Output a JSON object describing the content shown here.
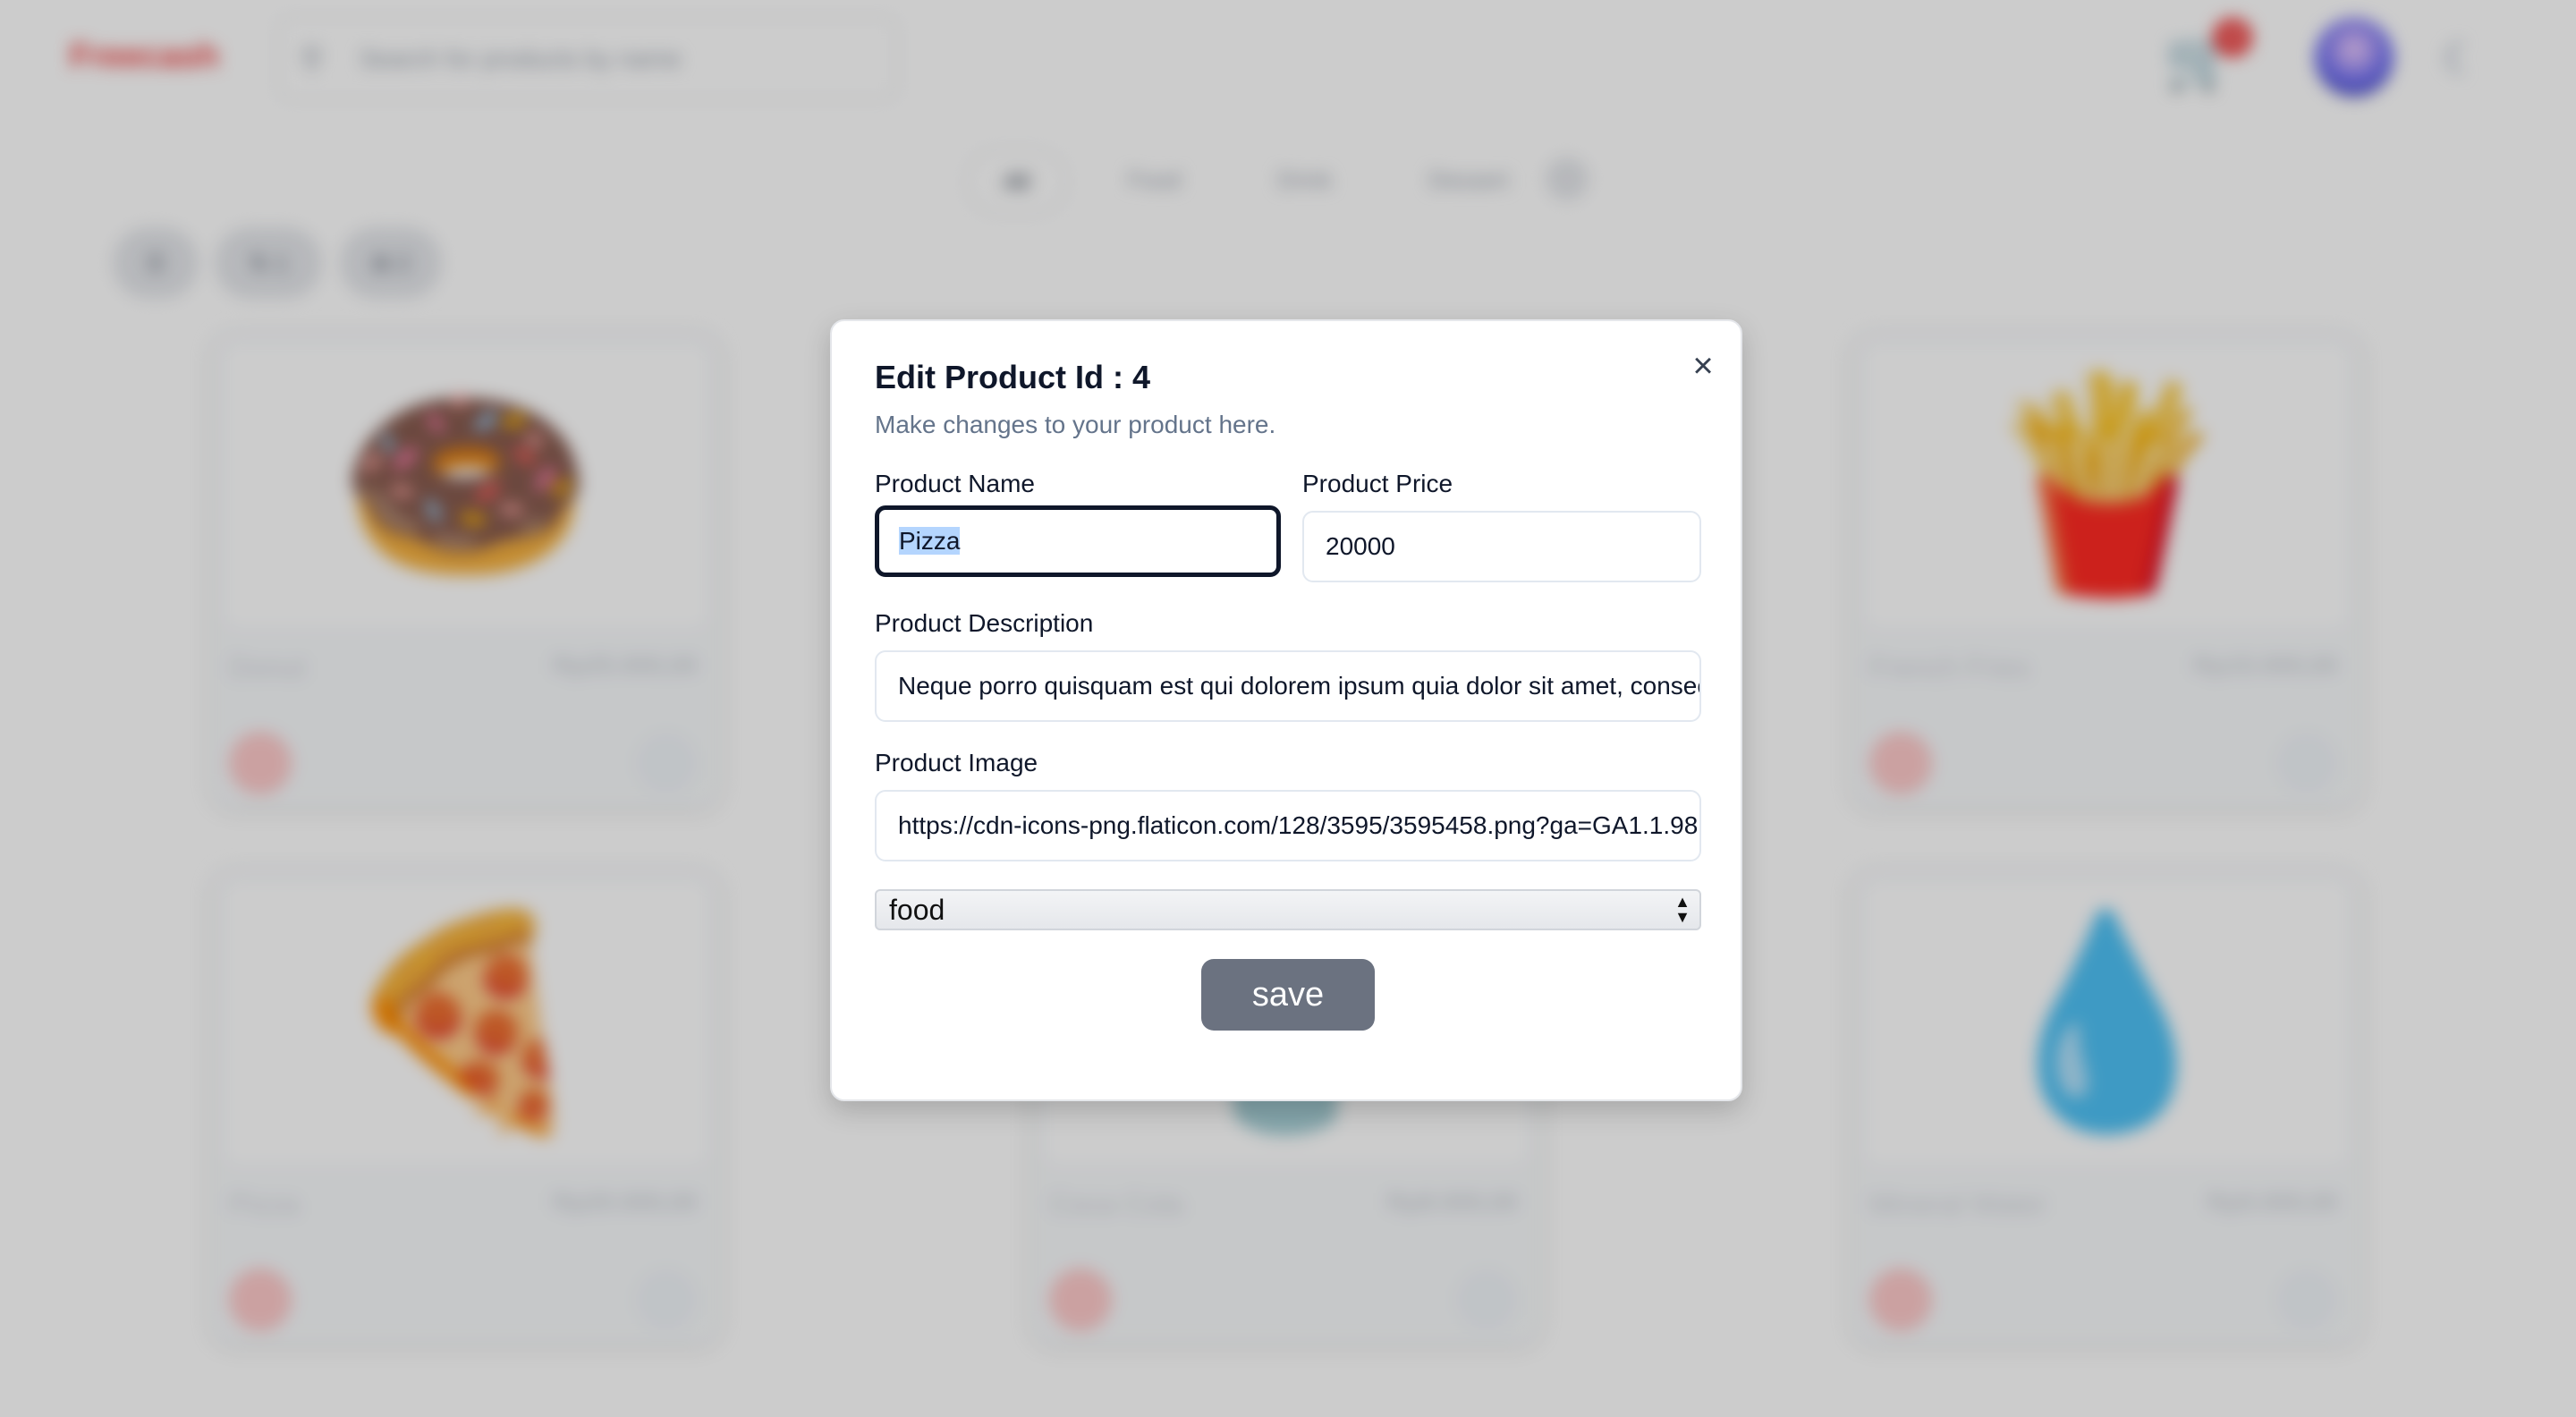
{
  "background": {
    "logo": "Freecash",
    "search_placeholder": "Search for products by name",
    "cart_count": "3",
    "categories": [
      "All",
      "Food",
      "Drink",
      "Dessert"
    ],
    "tools": [
      "☰",
      "⇅ 1",
      "⊞ 2"
    ],
    "cards": [
      {
        "name": "Donut",
        "price": "Rp25.000,00",
        "emoji": "🍩"
      },
      {
        "name": "French Fries",
        "price": "Rp15.000,00",
        "emoji": "🍟"
      },
      {
        "name": "Pizza",
        "price": "Rp20.000,00",
        "emoji": "🍕"
      },
      {
        "name": "Coca Cola",
        "price": "Rp8.000,00",
        "emoji": "🥤"
      },
      {
        "name": "Mineral Water",
        "price": "Rp5.000,00",
        "emoji": "💧"
      }
    ]
  },
  "dialog": {
    "title": "Edit Product Id : 4",
    "subtitle": "Make changes to your product here.",
    "close_symbol": "×",
    "name_label": "Product Name",
    "name_value": "Pizza",
    "price_label": "Product Price",
    "price_value": "20000",
    "description_label": "Product Description",
    "description_value": "Neque porro quisquam est qui dolorem ipsum quia dolor sit amet, consectetur, adipisci velit",
    "image_label": "Product Image",
    "image_value": "https://cdn-icons-png.flaticon.com/128/3595/3595458.png?ga=GA1.1.98",
    "category_value": "food",
    "save_label": "save"
  }
}
